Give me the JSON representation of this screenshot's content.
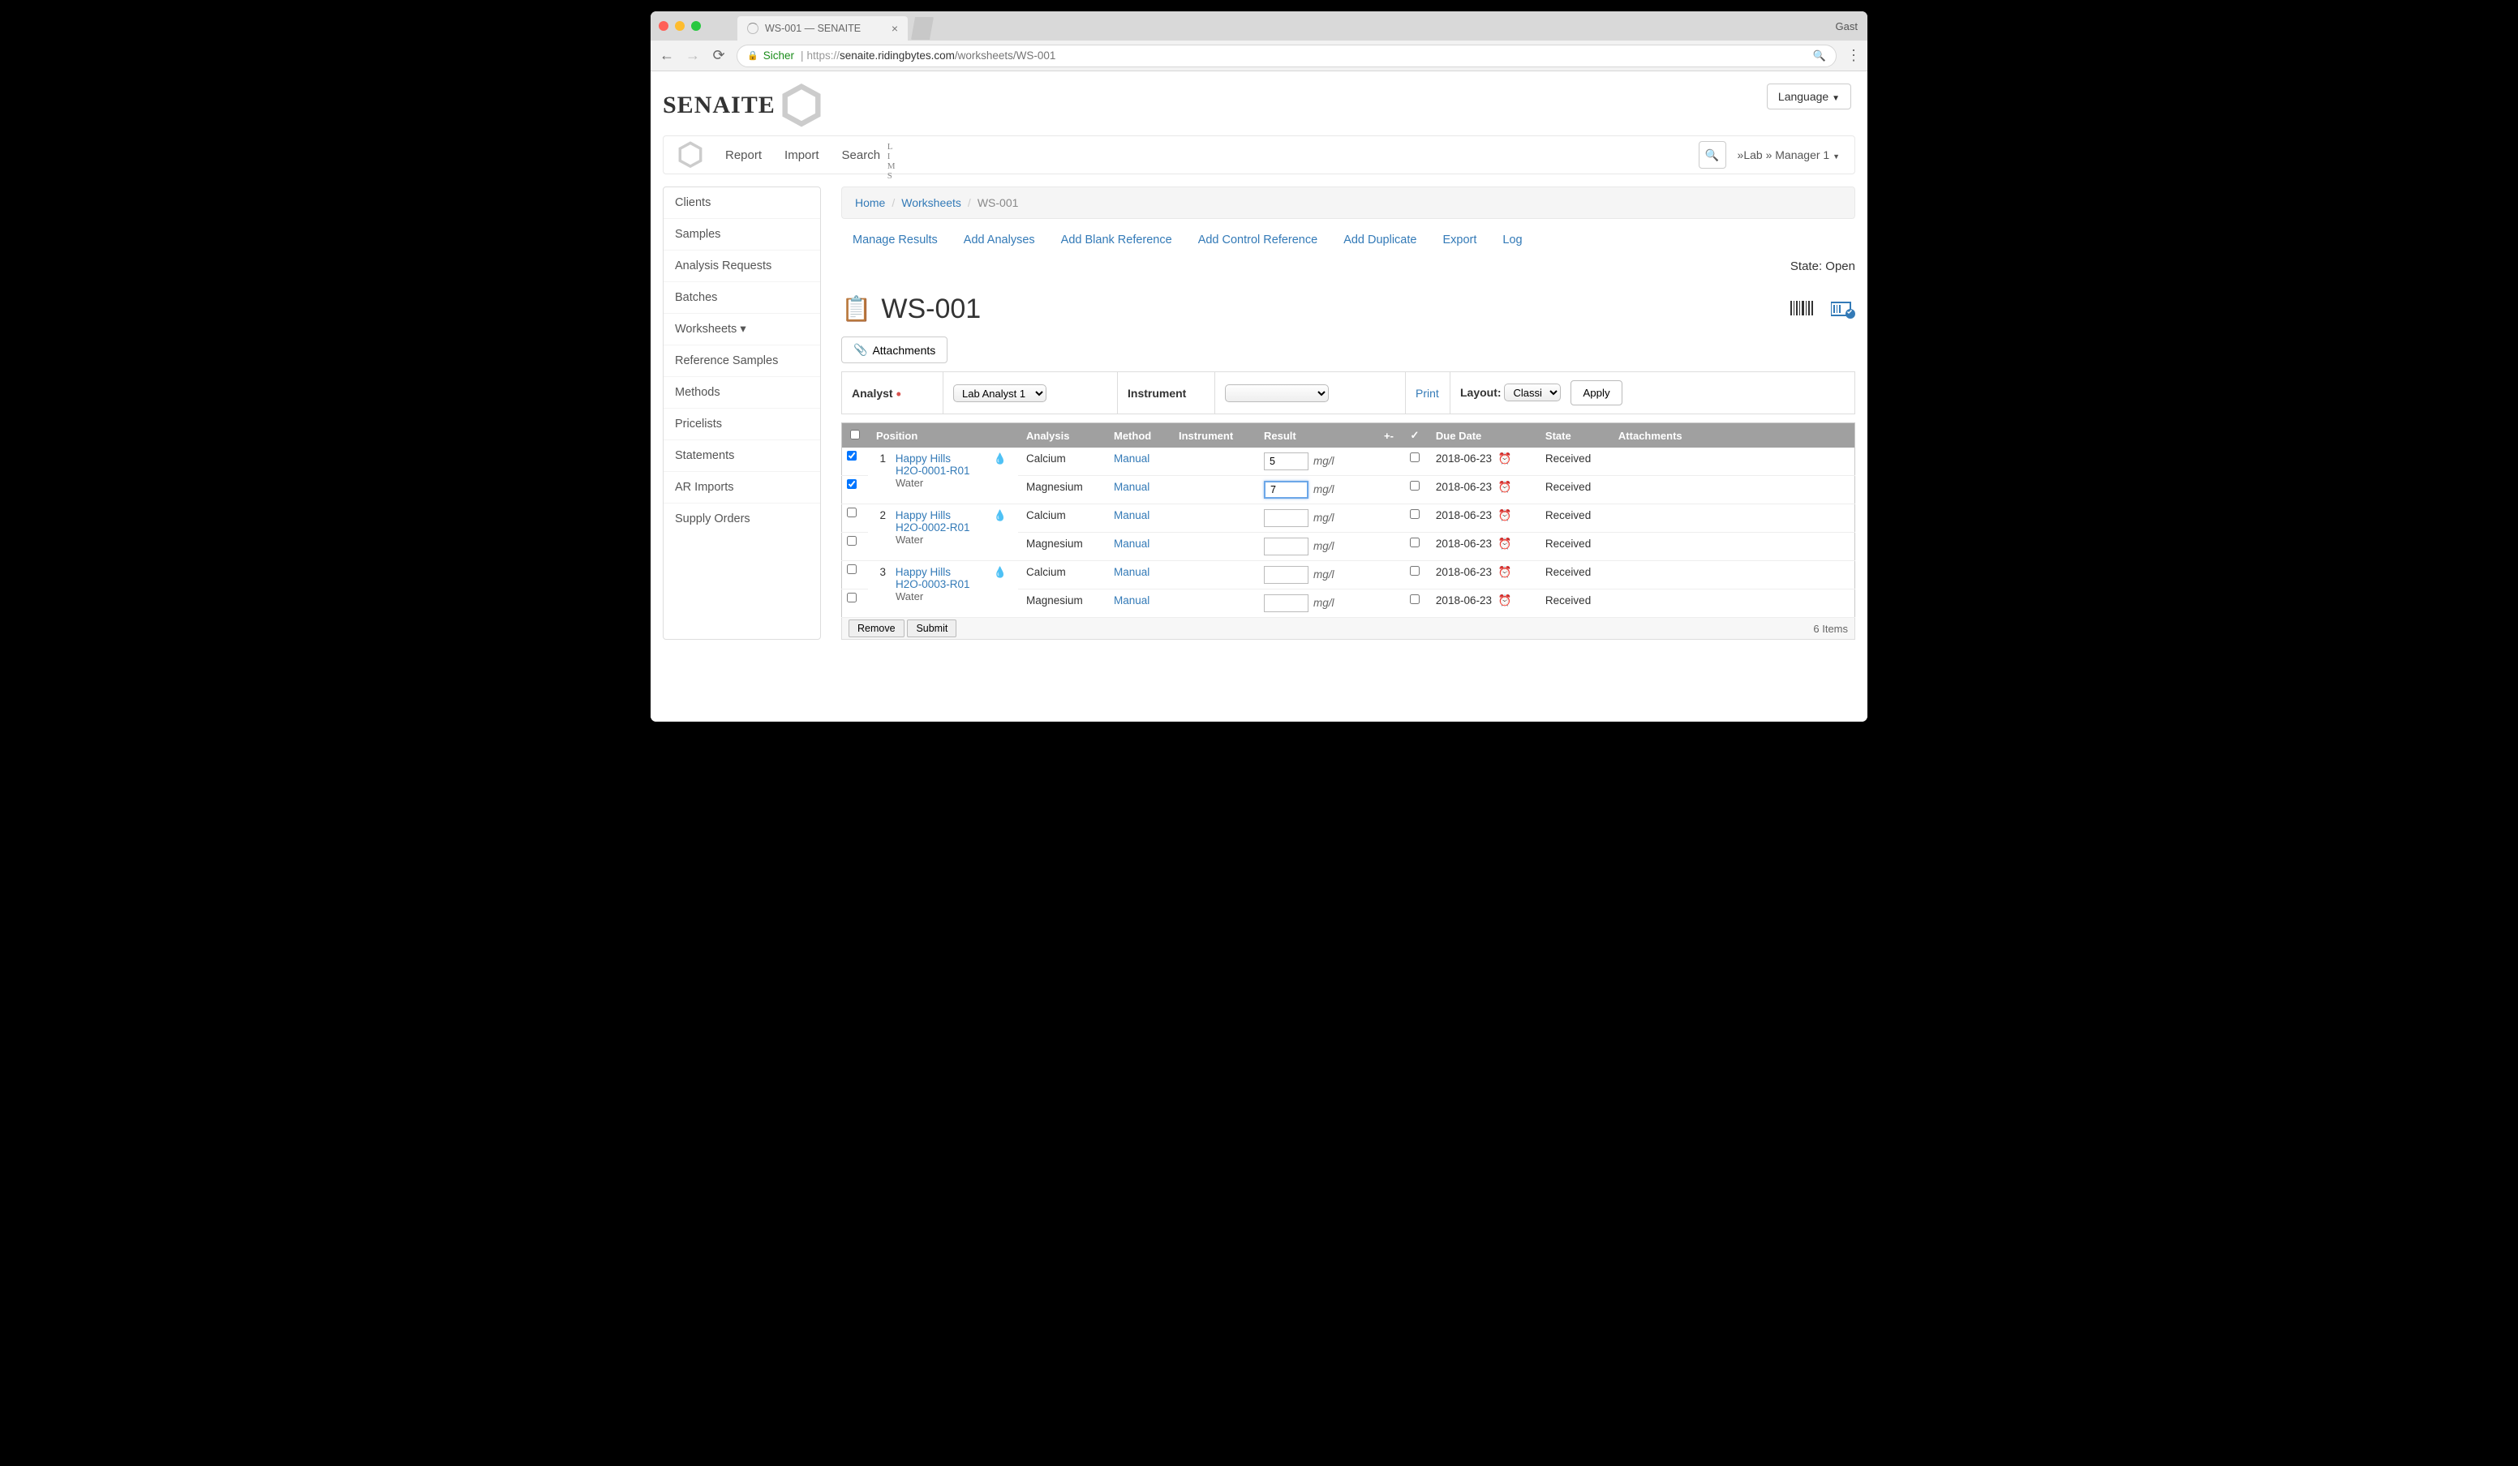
{
  "browser": {
    "tab_title": "WS-001 — SENAITE",
    "user_label": "Gast",
    "secure_label": "Sicher",
    "url_proto": "https://",
    "url_host": "senaite.ridingbytes.com",
    "url_path": "/worksheets/WS-001"
  },
  "header": {
    "logo_main": "SENAITE",
    "logo_sub": "L I M S",
    "language_btn": "Language"
  },
  "mainnav": {
    "items": [
      "Report",
      "Import",
      "Search"
    ],
    "userpath": "»Lab » Manager 1"
  },
  "sidebar": {
    "items": [
      "Clients",
      "Samples",
      "Analysis Requests",
      "Batches",
      "Worksheets ▾",
      "Reference Samples",
      "Methods",
      "Pricelists",
      "Statements",
      "AR Imports",
      "Supply Orders"
    ]
  },
  "breadcrumb": {
    "items": [
      "Home",
      "Worksheets",
      "WS-001"
    ]
  },
  "tabs": {
    "items": [
      "Manage Results",
      "Add Analyses",
      "Add Blank Reference",
      "Add Control Reference",
      "Add Duplicate",
      "Export",
      "Log"
    ]
  },
  "state": {
    "label": "State:",
    "value": "Open"
  },
  "title": "WS-001",
  "attachments_btn": "Attachments",
  "config": {
    "analyst_label": "Analyst",
    "analyst_value": "Lab Analyst 1",
    "instrument_label": "Instrument",
    "instrument_value": "",
    "print": "Print",
    "layout_label": "Layout:",
    "layout_value": "Classic",
    "apply": "Apply"
  },
  "table": {
    "headers": {
      "position": "Position",
      "analysis": "Analysis",
      "method": "Method",
      "instrument": "Instrument",
      "result": "Result",
      "spec": "+-",
      "verified": "✓",
      "due_date": "Due Date",
      "state": "State",
      "attachments": "Attachments"
    },
    "rows": [
      {
        "pos": "1",
        "client": "Happy Hills",
        "sample": "H2O-0001-R01",
        "type": "Water",
        "checked": true,
        "sub": [
          {
            "checked": true,
            "analysis": "Calcium",
            "method": "Manual",
            "result_value": "5",
            "unit": "mg/l",
            "due": "2018-06-23",
            "state": "Received",
            "active": false
          },
          {
            "checked": true,
            "analysis": "Magnesium",
            "method": "Manual",
            "result_value": "7",
            "unit": "mg/l",
            "due": "2018-06-23",
            "state": "Received",
            "active": true
          }
        ]
      },
      {
        "pos": "2",
        "client": "Happy Hills",
        "sample": "H2O-0002-R01",
        "type": "Water",
        "checked": false,
        "sub": [
          {
            "checked": false,
            "analysis": "Calcium",
            "method": "Manual",
            "result_value": "",
            "unit": "mg/l",
            "due": "2018-06-23",
            "state": "Received",
            "active": false
          },
          {
            "checked": false,
            "analysis": "Magnesium",
            "method": "Manual",
            "result_value": "",
            "unit": "mg/l",
            "due": "2018-06-23",
            "state": "Received",
            "active": false
          }
        ]
      },
      {
        "pos": "3",
        "client": "Happy Hills",
        "sample": "H2O-0003-R01",
        "type": "Water",
        "checked": false,
        "sub": [
          {
            "checked": false,
            "analysis": "Calcium",
            "method": "Manual",
            "result_value": "",
            "unit": "mg/l",
            "due": "2018-06-23",
            "state": "Received",
            "active": false
          },
          {
            "checked": false,
            "analysis": "Magnesium",
            "method": "Manual",
            "result_value": "",
            "unit": "mg/l",
            "due": "2018-06-23",
            "state": "Received",
            "active": false
          }
        ]
      }
    ],
    "remove_btn": "Remove",
    "submit_btn": "Submit",
    "items_count": "6 Items"
  }
}
